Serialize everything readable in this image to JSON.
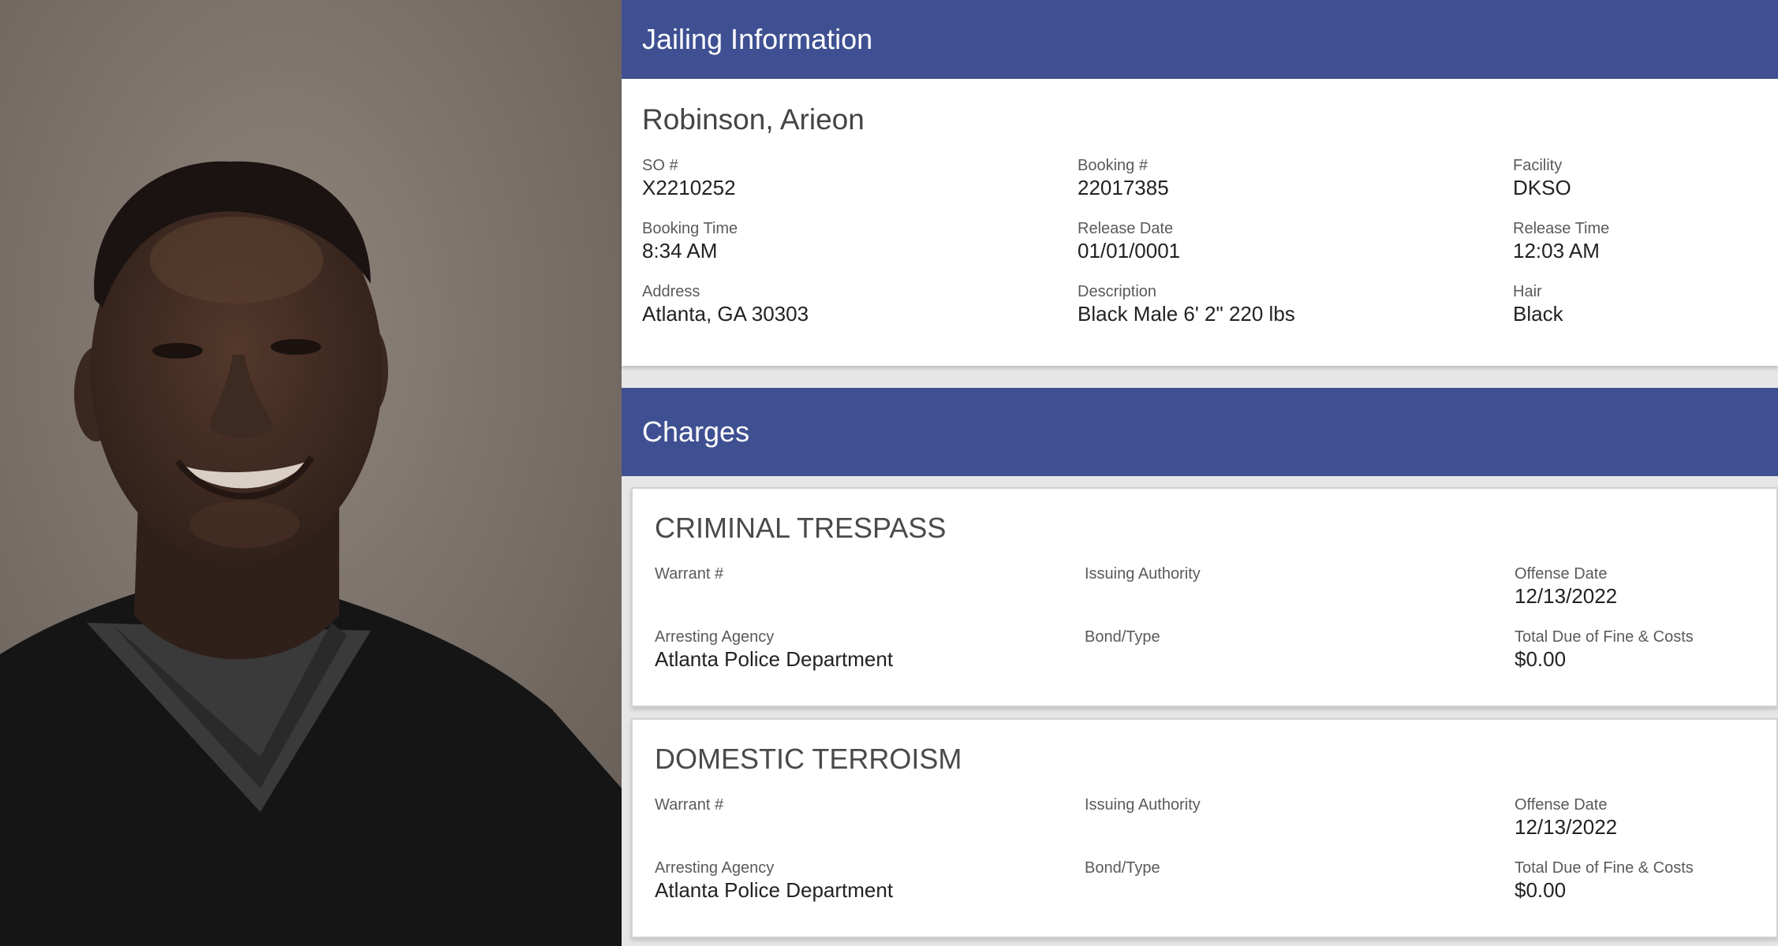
{
  "jailing": {
    "header": "Jailing Information",
    "name": "Robinson, Arieon",
    "fields": [
      {
        "label": "SO #",
        "value": "X2210252"
      },
      {
        "label": "Booking #",
        "value": "22017385"
      },
      {
        "label": "Facility",
        "value": "DKSO"
      },
      {
        "label": "Booking Time",
        "value": "8:34 AM"
      },
      {
        "label": "Release Date",
        "value": "01/01/0001"
      },
      {
        "label": "Release Time",
        "value": "12:03 AM"
      },
      {
        "label": "Address",
        "value": "Atlanta, GA 30303"
      },
      {
        "label": "Description",
        "value": "Black Male 6' 2\" 220 lbs"
      },
      {
        "label": "Hair",
        "value": "Black"
      }
    ]
  },
  "charges": {
    "header": "Charges",
    "items": [
      {
        "title": "CRIMINAL TRESPASS",
        "fields": [
          {
            "label": "Warrant #",
            "value": ""
          },
          {
            "label": "Issuing Authority",
            "value": ""
          },
          {
            "label": "Offense Date",
            "value": "12/13/2022"
          },
          {
            "label": "Arresting Agency",
            "value": "Atlanta Police Department"
          },
          {
            "label": "Bond/Type",
            "value": ""
          },
          {
            "label": "Total Due of Fine & Costs",
            "value": "$0.00"
          }
        ]
      },
      {
        "title": "DOMESTIC TERROISM",
        "fields": [
          {
            "label": "Warrant #",
            "value": ""
          },
          {
            "label": "Issuing Authority",
            "value": ""
          },
          {
            "label": "Offense Date",
            "value": "12/13/2022"
          },
          {
            "label": "Arresting Agency",
            "value": "Atlanta Police Department"
          },
          {
            "label": "Bond/Type",
            "value": ""
          },
          {
            "label": "Total Due of Fine & Costs",
            "value": "$0.00"
          }
        ]
      }
    ]
  },
  "photo": {
    "icon": "booking-photo",
    "colors": {
      "background": "#7f756e",
      "skin": "#3b2820",
      "shirt": "#141414",
      "undershirt": "#3a3a3a"
    }
  },
  "colors": {
    "header_bg": "#3f5092",
    "card_bg": "#ffffff",
    "page_bg": "#e6e6e6"
  }
}
